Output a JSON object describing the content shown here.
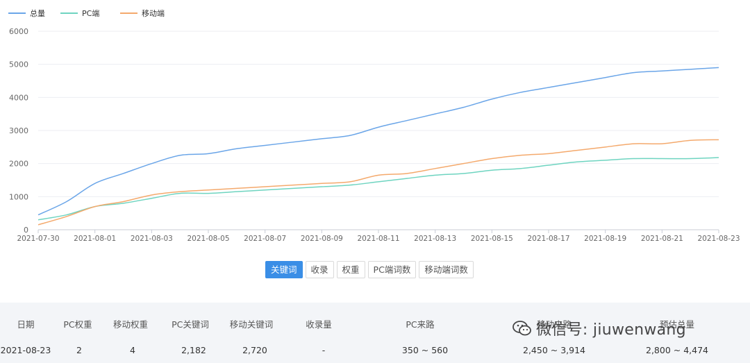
{
  "legend": [
    {
      "name": "总量",
      "color": "#6aa5e8"
    },
    {
      "name": "PC端",
      "color": "#6ed4c0"
    },
    {
      "name": "移动端",
      "color": "#f4a96c"
    }
  ],
  "chart_data": {
    "type": "line",
    "ylim": [
      0,
      6000
    ],
    "yticks": [
      0,
      1000,
      2000,
      3000,
      4000,
      5000,
      6000
    ],
    "x": [
      "2021-07-30",
      "2021-07-31",
      "2021-08-01",
      "2021-08-02",
      "2021-08-03",
      "2021-08-04",
      "2021-08-05",
      "2021-08-06",
      "2021-08-07",
      "2021-08-08",
      "2021-08-09",
      "2021-08-10",
      "2021-08-11",
      "2021-08-12",
      "2021-08-13",
      "2021-08-14",
      "2021-08-15",
      "2021-08-16",
      "2021-08-17",
      "2021-08-18",
      "2021-08-19",
      "2021-08-20",
      "2021-08-21",
      "2021-08-22",
      "2021-08-23"
    ],
    "xtick_labels": [
      "2021-07-30",
      "2021-08-01",
      "2021-08-03",
      "2021-08-05",
      "2021-08-07",
      "2021-08-09",
      "2021-08-11",
      "2021-08-13",
      "2021-08-15",
      "2021-08-17",
      "2021-08-19",
      "2021-08-21",
      "2021-08-23"
    ],
    "series": [
      {
        "name": "总量",
        "color": "#6aa5e8",
        "values": [
          450,
          850,
          1400,
          1700,
          2000,
          2250,
          2300,
          2450,
          2550,
          2650,
          2750,
          2850,
          3100,
          3300,
          3500,
          3700,
          3950,
          4150,
          4300,
          4450,
          4600,
          4750,
          4800,
          4850,
          4900
        ]
      },
      {
        "name": "PC端",
        "color": "#6ed4c0",
        "values": [
          300,
          450,
          700,
          800,
          950,
          1100,
          1100,
          1150,
          1200,
          1250,
          1300,
          1350,
          1450,
          1550,
          1650,
          1700,
          1800,
          1850,
          1950,
          2050,
          2100,
          2150,
          2150,
          2150,
          2182
        ]
      },
      {
        "name": "移动端",
        "color": "#f4a96c",
        "values": [
          150,
          400,
          700,
          850,
          1050,
          1150,
          1200,
          1250,
          1300,
          1350,
          1400,
          1450,
          1650,
          1700,
          1850,
          2000,
          2150,
          2250,
          2300,
          2400,
          2500,
          2600,
          2600,
          2700,
          2720
        ]
      }
    ]
  },
  "buttons": [
    {
      "label": "关键词",
      "active": true
    },
    {
      "label": "收录",
      "active": false
    },
    {
      "label": "权重",
      "active": false
    },
    {
      "label": "PC端词数",
      "active": false
    },
    {
      "label": "移动端词数",
      "active": false
    }
  ],
  "table": {
    "headers": [
      "日期",
      "PC权重",
      "移动权重",
      "PC关键词",
      "移动关键词",
      "收录量",
      "PC来路",
      "移动来路",
      "预估总量"
    ],
    "row": [
      "2021-08-23",
      "2",
      "4",
      "2,182",
      "2,720",
      "-",
      "350 ~ 560",
      "2,450 ~ 3,914",
      "2,800 ~ 4,474"
    ]
  },
  "watermark": {
    "text": "微信号: jiuwenwang"
  }
}
